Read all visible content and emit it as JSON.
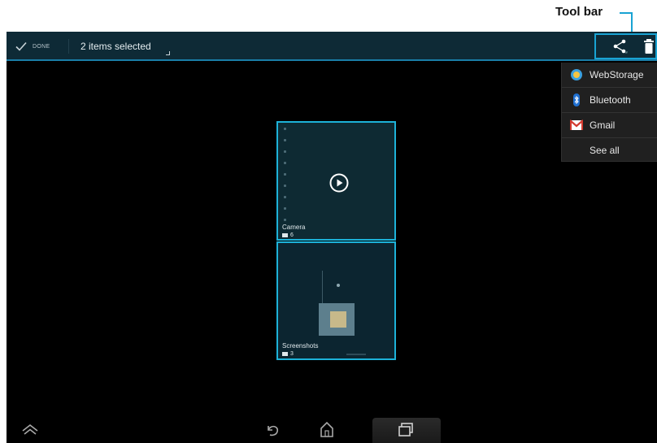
{
  "annotation": {
    "label": "Tool bar",
    "accent": "#19a3d3"
  },
  "actionbar": {
    "done_label": "DONE",
    "selection_text": "2 items selected",
    "background": "#0e2a36",
    "icons": [
      "check-icon",
      "share-icon",
      "trash-icon"
    ]
  },
  "share_menu": {
    "items": [
      {
        "label": "WebStorage",
        "icon": "webstorage-icon"
      },
      {
        "label": "Bluetooth",
        "icon": "bluetooth-icon"
      },
      {
        "label": "Gmail",
        "icon": "gmail-icon"
      },
      {
        "label": "See all",
        "icon": ""
      }
    ]
  },
  "albums": [
    {
      "title": "Camera",
      "count": "6"
    },
    {
      "title": "Screenshots",
      "count": "3"
    }
  ],
  "navbar": {
    "icons": [
      "asus-menu-icon",
      "back-icon",
      "home-icon",
      "recent-apps-icon"
    ]
  },
  "colors": {
    "selection_border": "#1db2d8",
    "screen_bg": "#000000"
  }
}
